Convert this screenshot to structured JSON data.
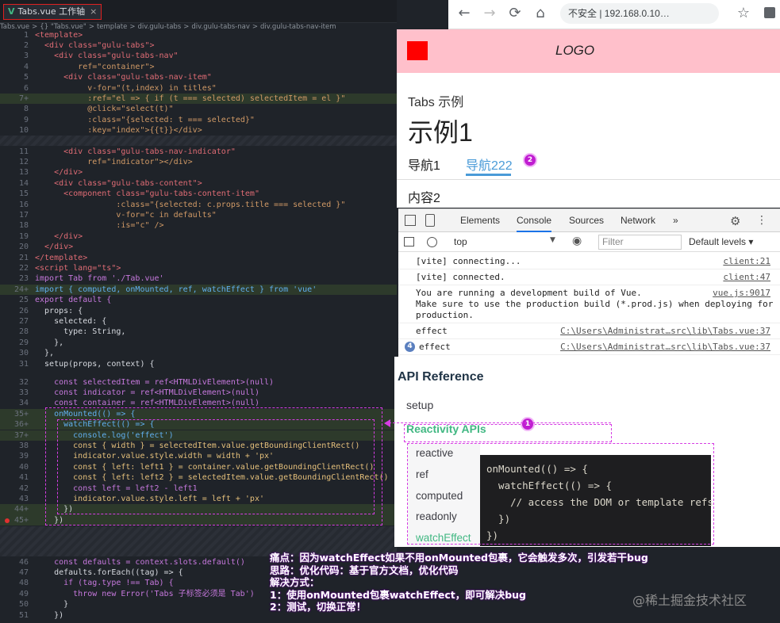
{
  "editor": {
    "tab_label": "Tabs.vue 工作轴",
    "tab_close": "×",
    "breadcrumb": [
      "Tabs.vue",
      ">",
      "{} \"Tabs.vue\"",
      ">",
      "template",
      ">",
      "div.gulu-tabs",
      ">",
      "div.gulu-tabs-nav",
      ">",
      "div.gulu-tabs-nav-item"
    ],
    "lines": [
      {
        "n": "1",
        "text": "<template>"
      },
      {
        "n": "2",
        "text": "  <div class=\"gulu-tabs\">"
      },
      {
        "n": "3",
        "text": "    <div class=\"gulu-tabs-nav\""
      },
      {
        "n": "4",
        "text": "         ref=\"container\">"
      },
      {
        "n": "5",
        "text": "      <div class=\"gulu-tabs-nav-item\""
      },
      {
        "n": "6",
        "text": "           v-for=\"(t,index) in titles\""
      },
      {
        "n": "7+",
        "text": "           :ref=\"el => { if (t === selected) selectedItem = el }\""
      },
      {
        "n": "8",
        "text": "           @click=\"select(t)\""
      },
      {
        "n": "9",
        "text": "           :class=\"{selected: t === selected}\""
      },
      {
        "n": "10",
        "text": "           :key=\"index\">{{t}}</div>"
      },
      {
        "n": "11",
        "text": "      <div class=\"gulu-tabs-nav-indicator\""
      },
      {
        "n": "12",
        "text": "           ref=\"indicator\"></div>"
      },
      {
        "n": "13",
        "text": "    </div>"
      },
      {
        "n": "14",
        "text": "    <div class=\"gulu-tabs-content\">"
      },
      {
        "n": "15",
        "text": "      <component class=\"gulu-tabs-content-item\""
      },
      {
        "n": "16",
        "text": "                 :class=\"{selected: c.props.title === selected }\""
      },
      {
        "n": "17",
        "text": "                 v-for=\"c in defaults\""
      },
      {
        "n": "18",
        "text": "                 :is=\"c\" />"
      },
      {
        "n": "19",
        "text": "    </div>"
      },
      {
        "n": "20",
        "text": "  </div>"
      },
      {
        "n": "21",
        "text": "</template>"
      },
      {
        "n": "22",
        "text": "<script lang=\"ts\">"
      },
      {
        "n": "23",
        "text": "import Tab from './Tab.vue'"
      },
      {
        "n": "24+",
        "text": "import { computed, onMounted, ref, watchEffect } from 'vue'"
      },
      {
        "n": "25",
        "text": "export default {"
      },
      {
        "n": "26",
        "text": "  props: {"
      },
      {
        "n": "27",
        "text": "    selected: {"
      },
      {
        "n": "28",
        "text": "      type: String,"
      },
      {
        "n": "29",
        "text": "    },"
      },
      {
        "n": "30",
        "text": "  },"
      },
      {
        "n": "31",
        "text": "  setup(props, context) {"
      },
      {
        "n": "32",
        "text": "    const selectedItem = ref<HTMLDivElement>(null)"
      },
      {
        "n": "33",
        "text": "    const indicator = ref<HTMLDivElement>(null)"
      },
      {
        "n": "34",
        "text": "    const container = ref<HTMLDivElement>(null)"
      },
      {
        "n": "35+",
        "text": "    onMounted(() => {"
      },
      {
        "n": "36+",
        "text": "      watchEffect(() => {"
      },
      {
        "n": "37+",
        "text": "        console.log('effect')"
      },
      {
        "n": "38",
        "text": "        const { width } = selectedItem.value.getBoundingClientRect()"
      },
      {
        "n": "39",
        "text": "        indicator.value.style.width = width + 'px'"
      },
      {
        "n": "40",
        "text": "        const { left: left1 } = container.value.getBoundingClientRect()"
      },
      {
        "n": "41",
        "text": "        const { left: left2 } = selectedItem.value.getBoundingClientRect()"
      },
      {
        "n": "42",
        "text": "        const left = left2 - left1"
      },
      {
        "n": "43",
        "text": "        indicator.value.style.left = left + 'px'"
      },
      {
        "n": "44+",
        "text": "      })"
      },
      {
        "n": "45+",
        "text": "    })"
      },
      {
        "n": "46",
        "text": "    const defaults = context.slots.default()"
      },
      {
        "n": "47",
        "text": "    defaults.forEach((tag) => {"
      },
      {
        "n": "48",
        "text": "      if (tag.type !== Tab) {"
      },
      {
        "n": "49",
        "text": "        throw new Error('Tabs 子标签必须是 Tab')"
      },
      {
        "n": "50",
        "text": "      }"
      },
      {
        "n": "51",
        "text": "    })"
      }
    ]
  },
  "browser": {
    "address": "不安全 | 192.168.0.10…",
    "back": "←",
    "forward": "→",
    "reload": "⟳",
    "home": "⌂",
    "star": "☆"
  },
  "page": {
    "logo": "LOGO",
    "subtitle": "Tabs 示例",
    "heading": "示例1",
    "nav_items": [
      "导航1",
      "导航222"
    ],
    "content": "内容2",
    "badge2": "2"
  },
  "devtools": {
    "tabs": [
      "Elements",
      "Console",
      "Sources",
      "Network",
      "»"
    ],
    "context": "top",
    "filter_placeholder": "Filter",
    "levels": "Default levels ▾",
    "logs": [
      {
        "msg": "[vite] connecting...",
        "src": "client:21"
      },
      {
        "msg": "[vite] connected.",
        "src": "client:47"
      },
      {
        "msg": "You are running a development build of Vue.\nMake sure to use the production build (*.prod.js) when deploying for\nproduction.",
        "src": "vue.js:9017"
      },
      {
        "msg": "effect",
        "src": "C:\\Users\\Administrat…src\\lib\\Tabs.vue:37"
      },
      {
        "msg": "effect",
        "src": "C:\\Users\\Administrat…src\\lib\\Tabs.vue:37",
        "count": "4"
      }
    ]
  },
  "docs": {
    "heading": "API Reference",
    "setup": "setup",
    "reactivity": "Reactivity APIs",
    "items": [
      "reactive",
      "ref",
      "computed",
      "readonly",
      "watchEffect"
    ],
    "snippet": "onMounted(() => {\n  watchEffect(() => {\n    // access the DOM or template refs\n  })\n})",
    "badge1": "1"
  },
  "note": {
    "lines": [
      "痛点：因为watchEffect如果不用onMounted包裹，它会触发多次，引发若干bug",
      "思路：优化代码：基于官方文档，优化代码",
      "解决方式：",
      "1：使用onMounted包裹watchEffect，即可解决bug",
      "2：测试，切换正常！"
    ]
  },
  "watermark": "@稀土掘金技术社区",
  "colors": {
    "accent": "#42b883",
    "badge": "#c01dd1",
    "link": "#4a9bd8",
    "header": "#ffc0cb"
  }
}
